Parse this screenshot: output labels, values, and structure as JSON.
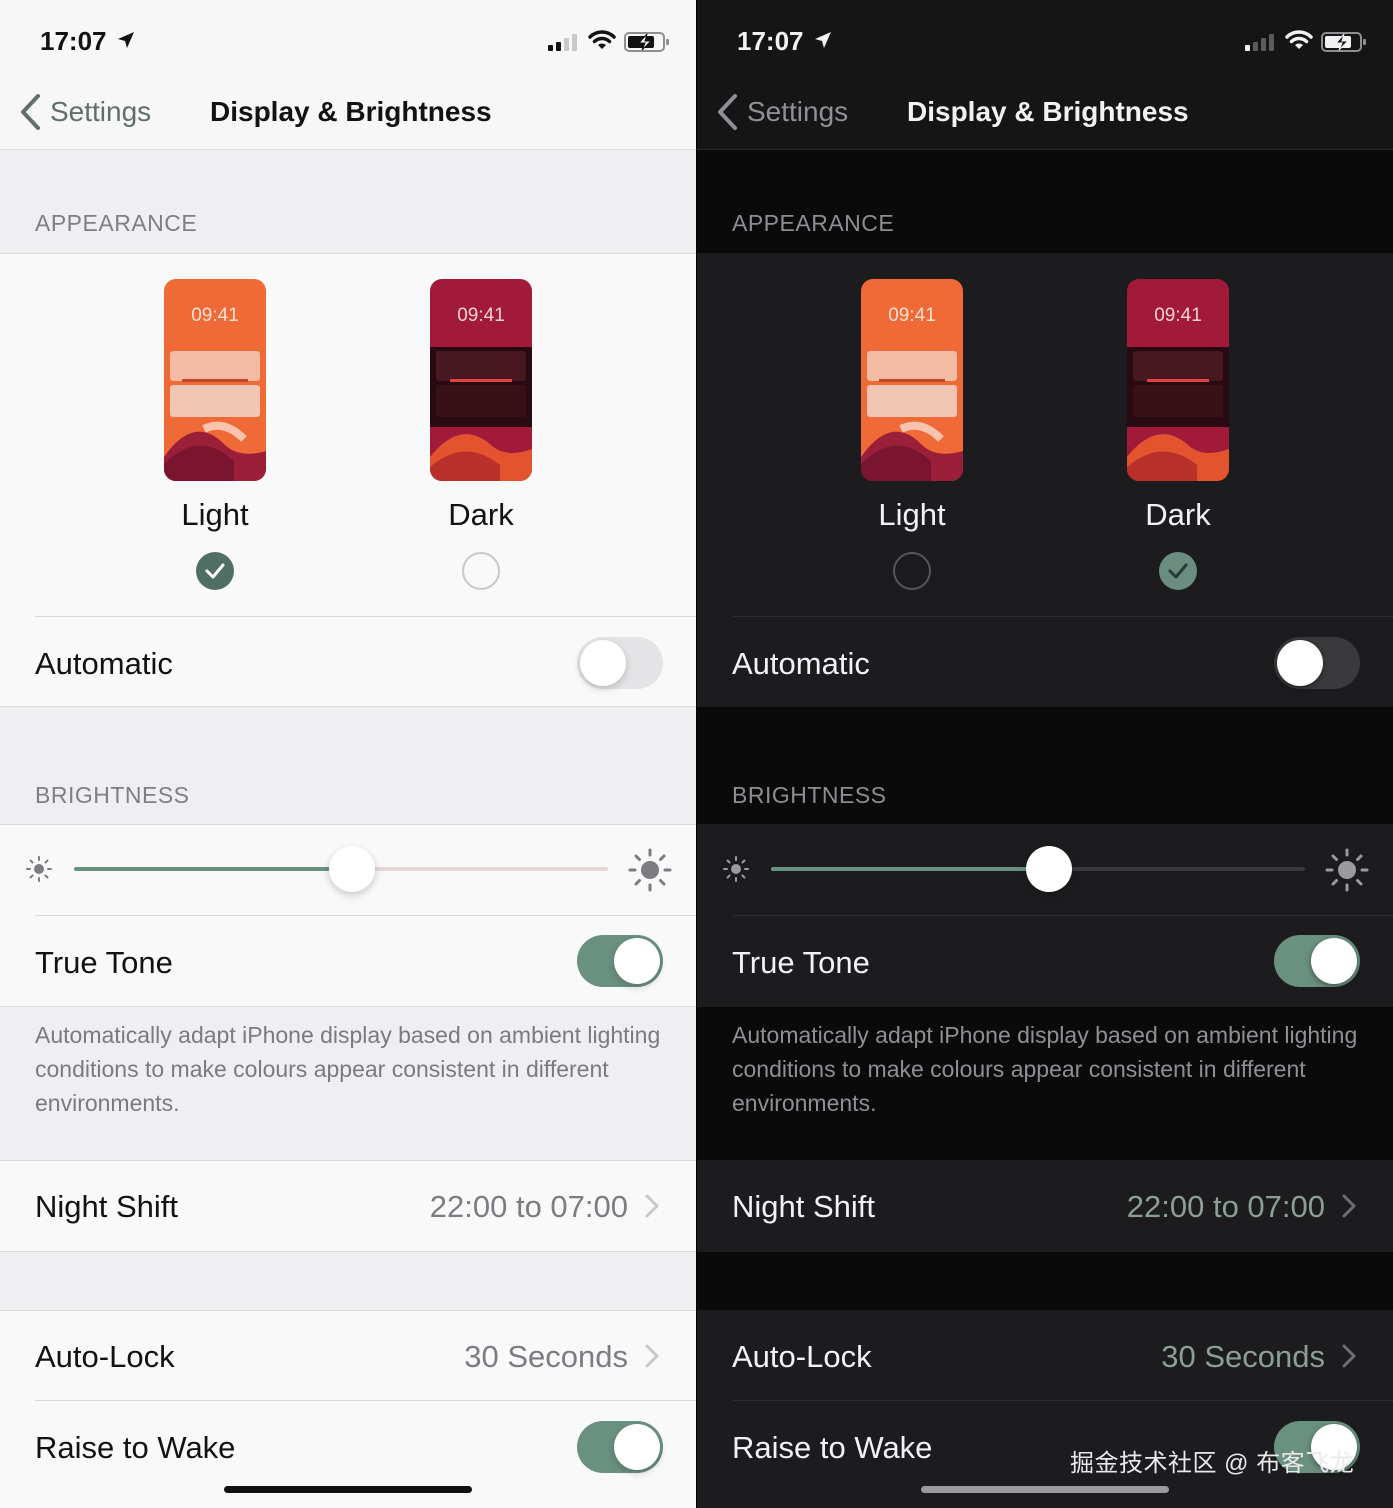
{
  "status_bar": {
    "time": "17:07"
  },
  "nav": {
    "back_label": "Settings",
    "title": "Display & Brightness"
  },
  "appearance": {
    "header": "APPEARANCE",
    "thumb_time": "09:41",
    "light_label": "Light",
    "dark_label": "Dark",
    "automatic_label": "Automatic"
  },
  "brightness": {
    "header": "BRIGHTNESS",
    "true_tone_label": "True Tone",
    "footer": "Automatically adapt iPhone display based on ambient lighting conditions to make colours appear consistent in different environments."
  },
  "night_shift": {
    "label": "Night Shift",
    "value": "22:00 to 07:00"
  },
  "auto_lock": {
    "label": "Auto-Lock",
    "value": "30 Seconds"
  },
  "raise_to_wake": {
    "label": "Raise to Wake"
  },
  "screens": {
    "light": {
      "selected_mode": "Light",
      "automatic_on": false,
      "true_tone_on": true,
      "raise_to_wake_on": true,
      "brightness_level": 0.52
    },
    "dark": {
      "selected_mode": "Dark",
      "automatic_on": false,
      "true_tone_on": true,
      "raise_to_wake_on": true,
      "brightness_level": 0.52
    }
  },
  "colors": {
    "accent_green": "#6a907f",
    "thumb_orange": "#ee6a38",
    "thumb_dark_red": "#7a1530"
  },
  "icons": [
    "location-arrow-icon",
    "signal-icon",
    "wifi-icon",
    "battery-charging-icon",
    "chevron-left-icon",
    "checkmark-icon",
    "sun-small-icon",
    "sun-large-icon",
    "chevron-right-icon"
  ],
  "watermark": "掘金技术社区 @ 布客飞龙"
}
